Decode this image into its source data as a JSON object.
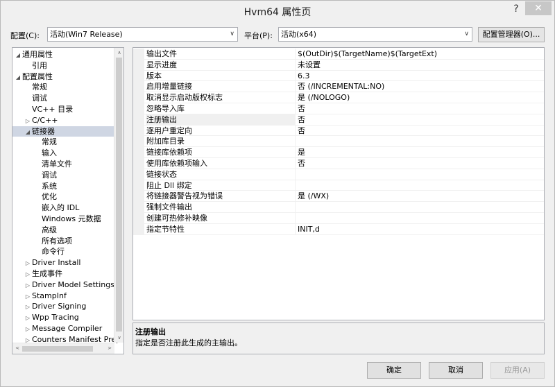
{
  "window": {
    "title": "Hvm64 属性页",
    "help_glyph": "?",
    "close_glyph": "✕"
  },
  "config": {
    "config_label": "配置(C):",
    "config_value": "活动(Win7 Release)",
    "platform_label": "平台(P):",
    "platform_value": "活动(x64)",
    "manager_button": "配置管理器(O)..."
  },
  "tree": {
    "items": [
      {
        "label": "通用属性",
        "expand": "◢"
      },
      {
        "label": "引用",
        "expand": ""
      },
      {
        "label": "配置属性",
        "expand": "◢"
      },
      {
        "label": "常规",
        "expand": ""
      },
      {
        "label": "调试",
        "expand": ""
      },
      {
        "label": "VC++ 目录",
        "expand": ""
      },
      {
        "label": "C/C++",
        "expand": "▷"
      },
      {
        "label": "链接器",
        "expand": "◢"
      },
      {
        "label": "常规",
        "expand": ""
      },
      {
        "label": "输入",
        "expand": ""
      },
      {
        "label": "清单文件",
        "expand": ""
      },
      {
        "label": "调试",
        "expand": ""
      },
      {
        "label": "系统",
        "expand": ""
      },
      {
        "label": "优化",
        "expand": ""
      },
      {
        "label": "嵌入的 IDL",
        "expand": ""
      },
      {
        "label": "Windows 元数据",
        "expand": ""
      },
      {
        "label": "高级",
        "expand": ""
      },
      {
        "label": "所有选项",
        "expand": ""
      },
      {
        "label": "命令行",
        "expand": ""
      },
      {
        "label": "Driver Install",
        "expand": "▷"
      },
      {
        "label": "生成事件",
        "expand": "▷"
      },
      {
        "label": "Driver Model Settings",
        "expand": "▷"
      },
      {
        "label": "StampInf",
        "expand": "▷"
      },
      {
        "label": "Driver Signing",
        "expand": "▷"
      },
      {
        "label": "Wpp Tracing",
        "expand": "▷"
      },
      {
        "label": "Message Compiler",
        "expand": "▷"
      },
      {
        "label": "Counters Manifest Prep",
        "expand": "▷"
      }
    ],
    "selected_index": 7
  },
  "properties": [
    {
      "name": "输出文件",
      "value": "$(OutDir)$(TargetName)$(TargetExt)"
    },
    {
      "name": "显示进度",
      "value": "未设置"
    },
    {
      "name": "版本",
      "value": "6.3"
    },
    {
      "name": "启用增量链接",
      "value": "否 (/INCREMENTAL:NO)"
    },
    {
      "name": "取消显示启动版权标志",
      "value": "是 (/NOLOGO)"
    },
    {
      "name": "忽略导入库",
      "value": "否"
    },
    {
      "name": "注册输出",
      "value": "否"
    },
    {
      "name": "逐用户重定向",
      "value": "否"
    },
    {
      "name": "附加库目录",
      "value": ""
    },
    {
      "name": "链接库依赖项",
      "value": "是"
    },
    {
      "name": "使用库依赖项输入",
      "value": "否"
    },
    {
      "name": "链接状态",
      "value": ""
    },
    {
      "name": "阻止 Dll 绑定",
      "value": ""
    },
    {
      "name": "将链接器警告视为错误",
      "value": "是 (/WX)"
    },
    {
      "name": "强制文件输出",
      "value": ""
    },
    {
      "name": "创建可热修补映像",
      "value": ""
    },
    {
      "name": "指定节特性",
      "value": "INIT,d"
    }
  ],
  "active_property_index": 6,
  "description": {
    "title": "注册输出",
    "text": "指定是否注册此生成的主输出。"
  },
  "buttons": {
    "ok": "确定",
    "cancel": "取消",
    "apply": "应用(A)"
  },
  "icons": {
    "combo_arrow": "chevron-down-icon",
    "scroll_up": "∧",
    "scroll_down": "∨",
    "scroll_left": "<",
    "scroll_right": ">"
  }
}
